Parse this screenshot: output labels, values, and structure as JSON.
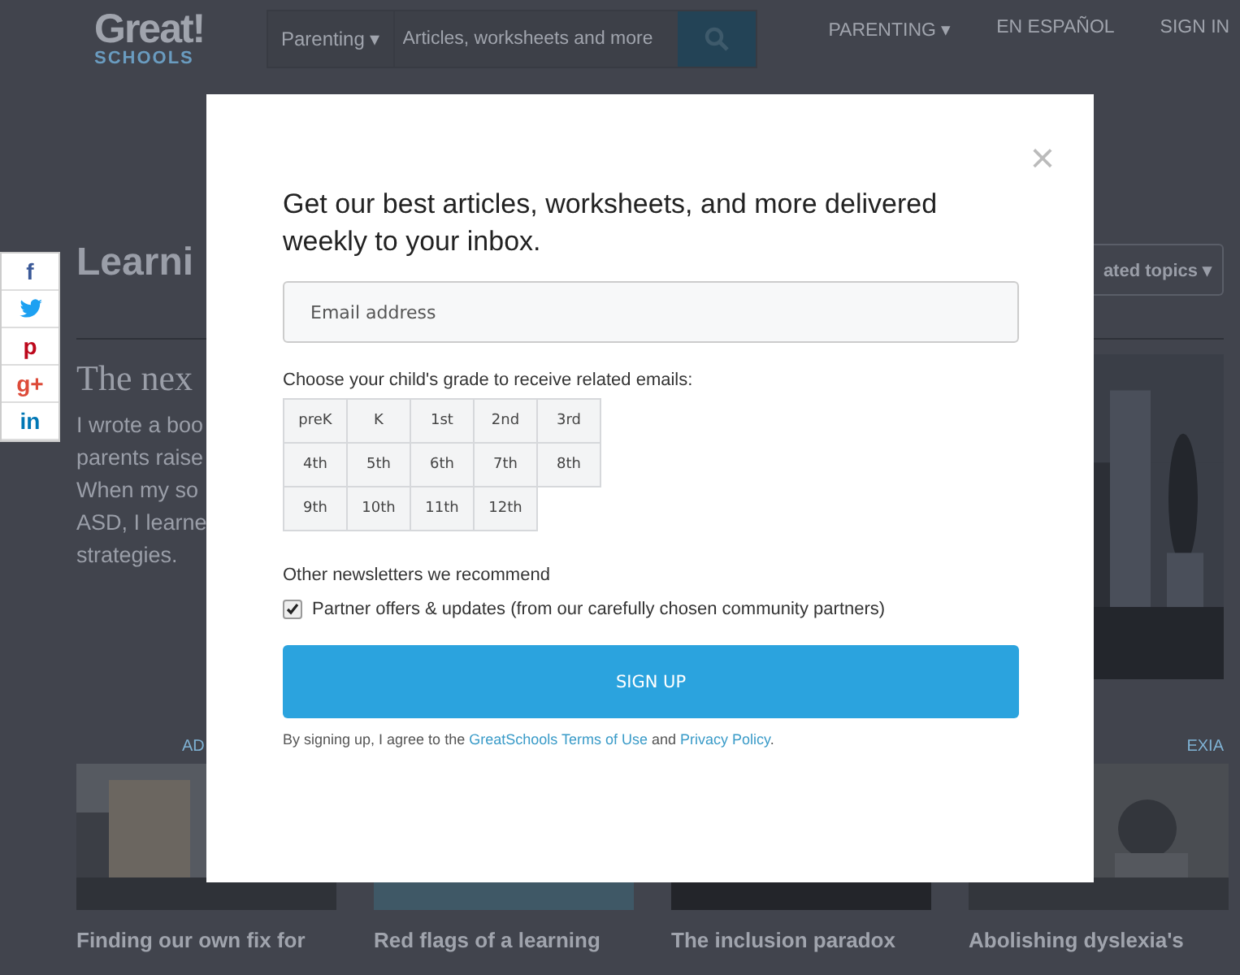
{
  "header": {
    "logo_top": "Great!",
    "logo_bottom": "SCHOOLS",
    "category": "Parenting ▾",
    "search": {
      "placeholder": "Articles, worksheets and more"
    },
    "nav": [
      "PARENTING ▾",
      "EN ESPAÑOL",
      "SIGN IN"
    ]
  },
  "share": [
    {
      "kind": "text",
      "label": "f"
    },
    {
      "kind": "bird"
    },
    {
      "kind": "text",
      "label": "p"
    },
    {
      "kind": "text",
      "label": "g+"
    },
    {
      "kind": "text",
      "label": "in"
    }
  ],
  "article": {
    "title": "Learni",
    "subtitle": "The nex",
    "lines": [
      "I wrote a boo",
      "parents raise",
      "When my so",
      "ASD, I learne",
      "strategies."
    ],
    "topics_button": "ated topics ▾"
  },
  "categories": [
    "AD",
    "EXIA"
  ],
  "cards": [
    {
      "title": "Finding our own fix for"
    },
    {
      "title": "Red flags of a learning"
    },
    {
      "title": "The inclusion paradox"
    },
    {
      "title": "Abolishing dyslexia's"
    }
  ],
  "modal": {
    "close": "×",
    "heading": "Get our best articles, worksheets, and more delivered weekly to your inbox.",
    "email": {
      "placeholder": "Email address"
    },
    "grade_prompt": "Choose your child's grade to receive related emails:",
    "grades": [
      "preK",
      "K",
      "1st",
      "2nd",
      "3rd",
      "4th",
      "5th",
      "6th",
      "7th",
      "8th",
      "9th",
      "10th",
      "11th",
      "12th"
    ],
    "other_label": "Other newsletters we recommend",
    "partner": {
      "label": "Partner offers & updates (from our carefully chosen community partners)",
      "checked": true
    },
    "submit": "SIGN UP",
    "legal": {
      "prefix": "By signing up, I agree to the",
      "terms": "GreatSchools Terms of Use",
      "middle": "and",
      "privacy": "Privacy Policy",
      "suffix": "."
    }
  }
}
